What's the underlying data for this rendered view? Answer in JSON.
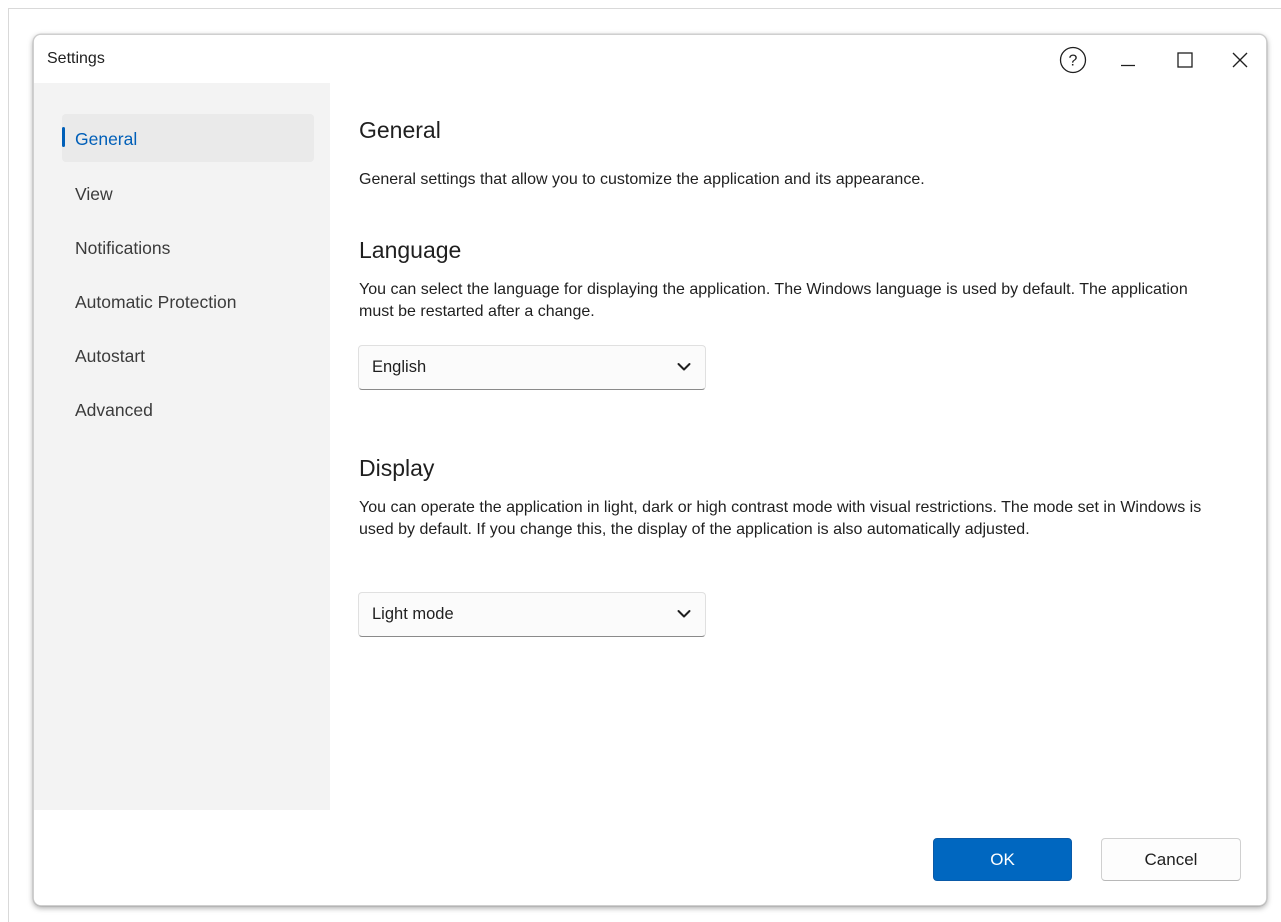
{
  "window": {
    "title": "Settings"
  },
  "titlebar": {
    "help_icon": "help-circle-icon",
    "minimize_icon": "minimize-icon",
    "maximize_icon": "maximize-icon",
    "close_icon": "close-icon"
  },
  "sidebar": {
    "items": [
      {
        "label": "General",
        "active": true
      },
      {
        "label": "View",
        "active": false
      },
      {
        "label": "Notifications",
        "active": false
      },
      {
        "label": "Automatic Protection",
        "active": false
      },
      {
        "label": "Autostart",
        "active": false
      },
      {
        "label": "Advanced",
        "active": false
      }
    ]
  },
  "main": {
    "title": "General",
    "description": "General settings that allow you to customize the application and its appearance.",
    "language": {
      "heading": "Language",
      "description": "You can select the language for displaying the application. The Windows language is used by default. The application must be restarted after a change.",
      "selected": "English"
    },
    "display": {
      "heading": "Display",
      "description": "You can operate the application in light, dark or high contrast mode with visual restrictions. The mode set in Windows is used by default. If you change this, the display of the application is also automatically adjusted.",
      "selected": "Light mode"
    }
  },
  "footer": {
    "ok_label": "OK",
    "cancel_label": "Cancel"
  },
  "colors": {
    "accent": "#005fb8",
    "primary_button": "#0067c0",
    "sidebar_bg": "#f3f3f3"
  }
}
